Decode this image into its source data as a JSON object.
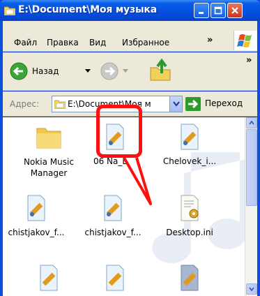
{
  "window": {
    "title": "E:\\Document\\Моя музыка"
  },
  "titlebar_buttons": [
    {
      "name": "minimize-button",
      "icon": "minimize-icon"
    },
    {
      "name": "maximize-button",
      "icon": "maximize-icon"
    },
    {
      "name": "close-button",
      "icon": "close-icon"
    }
  ],
  "menu": {
    "items": [
      {
        "label": "Файл"
      },
      {
        "label": "Правка"
      },
      {
        "label": "Вид"
      },
      {
        "label": "Избранное"
      }
    ],
    "overflow": "»"
  },
  "toolbar": {
    "back_label": "Назад",
    "overflow": "»"
  },
  "address": {
    "label": "Адрес:",
    "value": "E:\\Document\\Моя м",
    "go_label": "Переход"
  },
  "files": [
    {
      "label": "Nokia Music Manager",
      "icon": "folder-icon"
    },
    {
      "label": "06 Na_D...",
      "icon": "audio-file-icon"
    },
    {
      "label": "Chelovek_i...",
      "icon": "audio-file-icon"
    },
    {
      "label": "chistjakov_f...",
      "icon": "audio-file-icon"
    },
    {
      "label": "chistjakov_f...",
      "icon": "audio-file-icon"
    },
    {
      "label": "Desktop.ini",
      "icon": "settings-file-icon"
    },
    {
      "label": "",
      "icon": "audio-file-icon"
    },
    {
      "label": "",
      "icon": "audio-file-icon"
    },
    {
      "label": "",
      "icon": "audio-file-icon"
    }
  ],
  "colors": {
    "titlebar": "#0550e0",
    "highlight": "#ff1010",
    "chrome": "#ece9d8"
  }
}
